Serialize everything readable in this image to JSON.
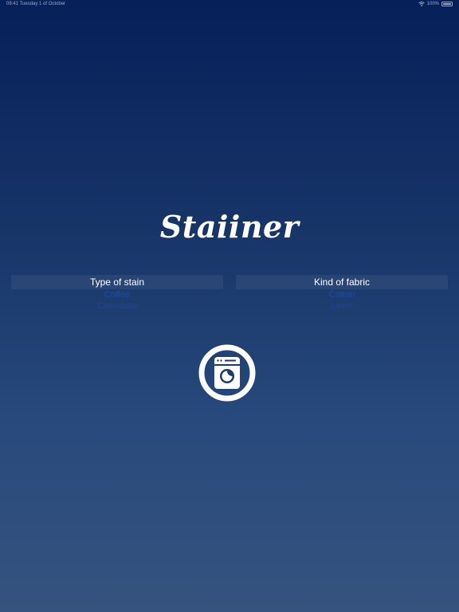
{
  "status_bar": {
    "carrier": "09:41  Tuesday 1 of October",
    "battery": "100%"
  },
  "app": {
    "title": "Staiiner"
  },
  "stain_picker": {
    "header": "Type of stain",
    "options": [
      "Coffee",
      "Chocolate"
    ]
  },
  "fabric_picker": {
    "header": "Kind of fabric",
    "options": [
      "Cotton",
      "Linen"
    ]
  },
  "wash_button": {
    "icon": "washing-machine-icon"
  },
  "colors": {
    "bg_top": "#06205a",
    "bg_bottom": "#36537f",
    "option_text": "#1f4fbf"
  }
}
